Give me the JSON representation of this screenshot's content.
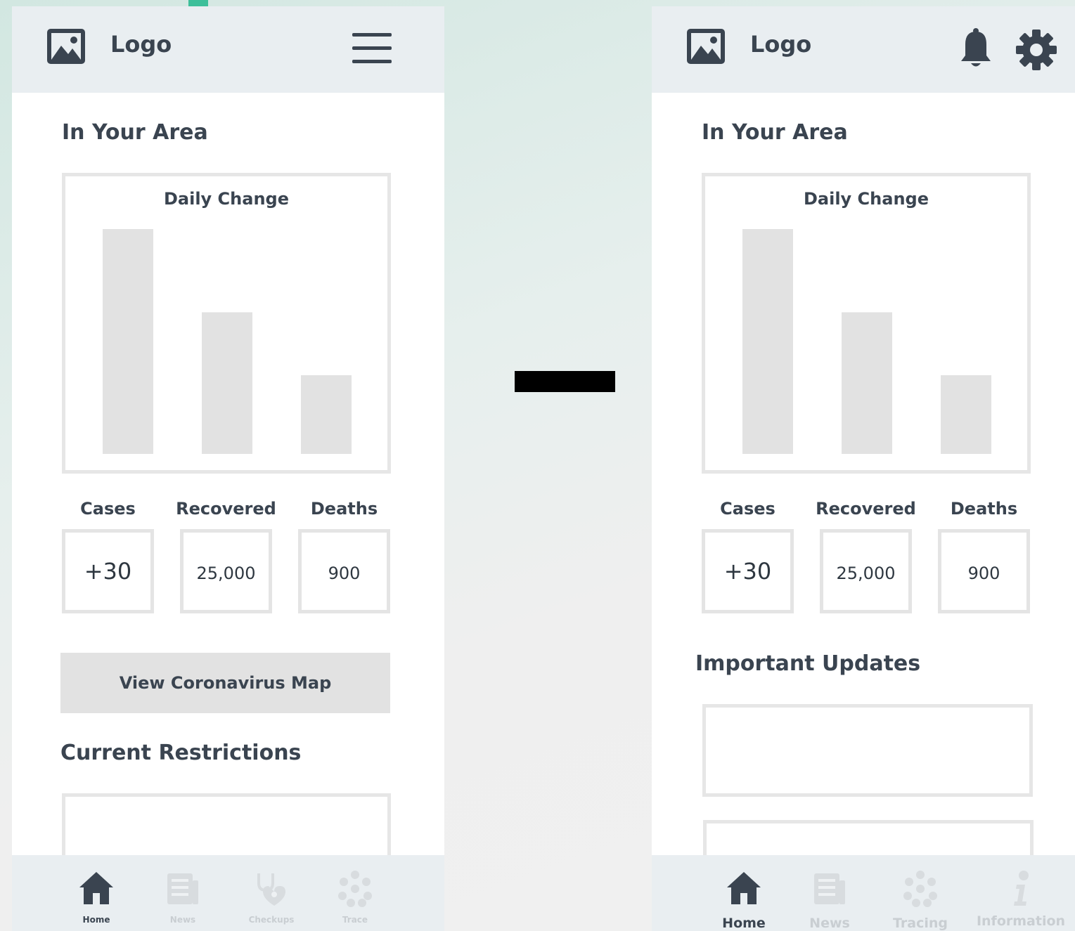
{
  "colors": {
    "accent": "#3dbf9a",
    "text": "#3a4450",
    "bar": "#e2e2e2",
    "nav_inactive": "#c9ced2"
  },
  "left_screen": {
    "logo": {
      "icon": "image-icon",
      "text": "Logo"
    },
    "menu": {
      "icon": "hamburger-menu-icon"
    },
    "area_title": "In Your Area",
    "chart_data": {
      "type": "bar",
      "title": "Daily Change",
      "categories": [
        "Cases",
        "Recovered",
        "Deaths"
      ],
      "values": [
        100,
        63,
        35
      ],
      "ylim": [
        0,
        100
      ],
      "xlabel": "",
      "ylabel": ""
    },
    "stats": [
      {
        "label": "Cases",
        "value": "+30"
      },
      {
        "label": "Recovered",
        "value": "25,000"
      },
      {
        "label": "Deaths",
        "value": "900"
      }
    ],
    "map_button": "View Coronavirus Map",
    "restrictions_title": "Current Restrictions",
    "nav": [
      {
        "label": "Home",
        "icon": "home-icon",
        "active": true
      },
      {
        "label": "News",
        "icon": "newspaper-icon",
        "active": false
      },
      {
        "label": "Checkups",
        "icon": "stethoscope-heart-icon",
        "active": false
      },
      {
        "label": "Trace",
        "icon": "contact-network-icon",
        "active": false
      }
    ]
  },
  "right_screen": {
    "logo": {
      "icon": "image-icon",
      "text": "Logo"
    },
    "header_icons": [
      "bell-icon",
      "gear-icon"
    ],
    "area_title": "In Your Area",
    "chart_data": {
      "type": "bar",
      "title": "Daily Change",
      "categories": [
        "Cases",
        "Recovered",
        "Deaths"
      ],
      "values": [
        100,
        63,
        35
      ],
      "ylim": [
        0,
        100
      ],
      "xlabel": "",
      "ylabel": ""
    },
    "stats": [
      {
        "label": "Cases",
        "value": "+30"
      },
      {
        "label": "Recovered",
        "value": "25,000"
      },
      {
        "label": "Deaths",
        "value": "900"
      }
    ],
    "updates_title": "Important Updates",
    "nav": [
      {
        "label": "Home",
        "icon": "home-icon",
        "active": true
      },
      {
        "label": "News",
        "icon": "newspaper-icon",
        "active": false
      },
      {
        "label": "Tracing",
        "icon": "contact-network-icon",
        "active": false
      },
      {
        "label": "Information",
        "icon": "info-icon",
        "active": false
      }
    ]
  }
}
